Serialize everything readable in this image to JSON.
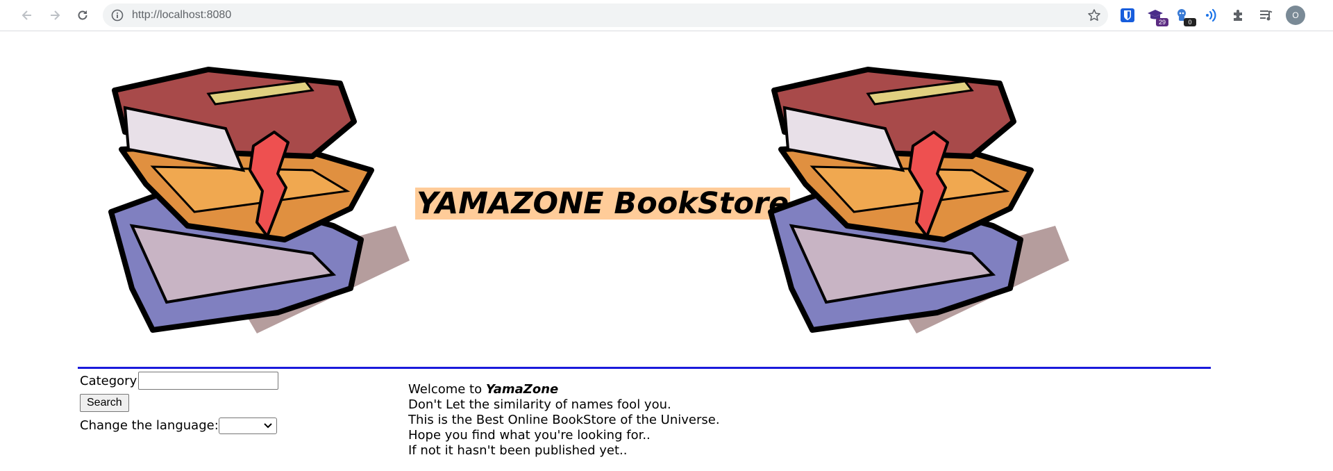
{
  "browser": {
    "url": "http://localhost:8080",
    "extensions": [
      {
        "name": "bitwarden-extension",
        "badge": ""
      },
      {
        "name": "school-extension",
        "badge": "29"
      },
      {
        "name": "robot-extension",
        "badge": "0"
      },
      {
        "name": "audio-extension",
        "badge": ""
      }
    ],
    "avatar_initial": "O"
  },
  "header": {
    "title": "YAMAZONE BookStore",
    "title_bg": "#ffcc99"
  },
  "colors": {
    "divider": "#1a1adb"
  },
  "search_form": {
    "category_label": "Category",
    "category_value": "",
    "search_button": "Search",
    "language_label": "Change the language:",
    "language_selected": ""
  },
  "welcome": {
    "prefix": "Welcome to ",
    "brand": "YamaZone",
    "lines": [
      "Don't Let the similarity of names fool you.",
      "This is the Best Online BookStore of the Universe.",
      "Hope you find what you're looking for..",
      "If not it hasn't been published yet.."
    ]
  }
}
